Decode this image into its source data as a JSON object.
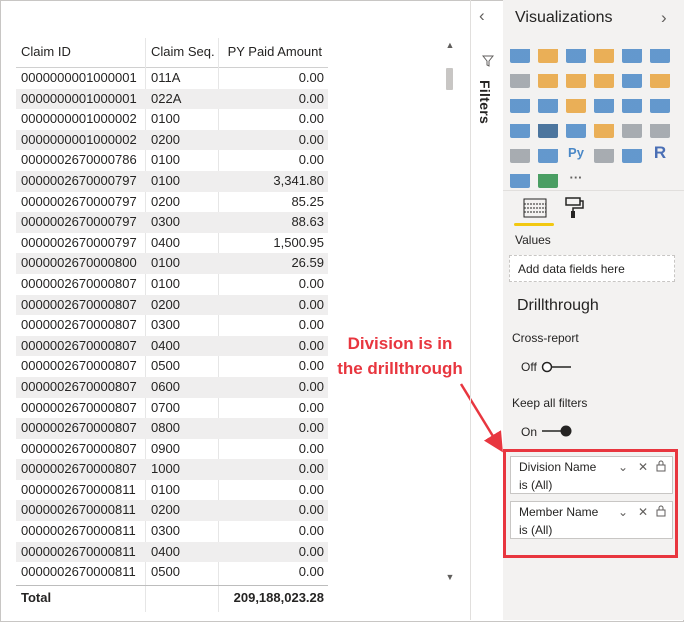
{
  "table": {
    "headers": [
      "Claim ID",
      "Claim Seq.",
      "PY Paid Amount"
    ],
    "rows": [
      [
        "0000000001000001",
        "011A",
        "0.00"
      ],
      [
        "0000000001000001",
        "022A",
        "0.00"
      ],
      [
        "0000000001000002",
        "0100",
        "0.00"
      ],
      [
        "0000000001000002",
        "0200",
        "0.00"
      ],
      [
        "0000002670000786",
        "0100",
        "0.00"
      ],
      [
        "0000002670000797",
        "0100",
        "3,341.80"
      ],
      [
        "0000002670000797",
        "0200",
        "85.25"
      ],
      [
        "0000002670000797",
        "0300",
        "88.63"
      ],
      [
        "0000002670000797",
        "0400",
        "1,500.95"
      ],
      [
        "0000002670000800",
        "0100",
        "26.59"
      ],
      [
        "0000002670000807",
        "0100",
        "0.00"
      ],
      [
        "0000002670000807",
        "0200",
        "0.00"
      ],
      [
        "0000002670000807",
        "0300",
        "0.00"
      ],
      [
        "0000002670000807",
        "0400",
        "0.00"
      ],
      [
        "0000002670000807",
        "0500",
        "0.00"
      ],
      [
        "0000002670000807",
        "0600",
        "0.00"
      ],
      [
        "0000002670000807",
        "0700",
        "0.00"
      ],
      [
        "0000002670000807",
        "0800",
        "0.00"
      ],
      [
        "0000002670000807",
        "0900",
        "0.00"
      ],
      [
        "0000002670000807",
        "1000",
        "0.00"
      ],
      [
        "0000002670000811",
        "0100",
        "0.00"
      ],
      [
        "0000002670000811",
        "0200",
        "0.00"
      ],
      [
        "0000002670000811",
        "0300",
        "0.00"
      ],
      [
        "0000002670000811",
        "0400",
        "0.00"
      ],
      [
        "0000002670000811",
        "0500",
        "0.00"
      ]
    ],
    "total": {
      "label": "Total",
      "value": "209,188,023.28"
    }
  },
  "filters_pane": {
    "label": "Filters",
    "collapse_icon": "chevron-left-icon",
    "funnel_icon": "funnel-icon"
  },
  "visualizations": {
    "title": "Visualizations",
    "expand_icon": "chevron-right-icon",
    "icons": [
      {
        "name": "stacked-bar-chart-icon",
        "color": "#4a88c7",
        "glyph": ""
      },
      {
        "name": "stacked-column-chart-icon",
        "color": "#e8a33c",
        "glyph": ""
      },
      {
        "name": "clustered-bar-chart-icon",
        "color": "#4a88c7",
        "glyph": ""
      },
      {
        "name": "clustered-column-chart-icon",
        "color": "#e8a33c",
        "glyph": ""
      },
      {
        "name": "100-stacked-bar-chart-icon",
        "color": "#4a88c7",
        "glyph": ""
      },
      {
        "name": "100-stacked-column-chart-icon",
        "color": "#4a88c7",
        "glyph": ""
      },
      {
        "name": "line-chart-icon",
        "color": "#9aa0a6",
        "glyph": ""
      },
      {
        "name": "area-chart-icon",
        "color": "#e8a33c",
        "glyph": ""
      },
      {
        "name": "stacked-area-chart-icon",
        "color": "#e8a33c",
        "glyph": ""
      },
      {
        "name": "line-and-column-chart-icon",
        "color": "#e8a33c",
        "glyph": ""
      },
      {
        "name": "line-and-clustered-column-chart-icon",
        "color": "#4a88c7",
        "glyph": ""
      },
      {
        "name": "ribbon-chart-icon",
        "color": "#e8a33c",
        "glyph": ""
      },
      {
        "name": "waterfall-chart-icon",
        "color": "#4a88c7",
        "glyph": ""
      },
      {
        "name": "scatter-chart-icon",
        "color": "#4a88c7",
        "glyph": ""
      },
      {
        "name": "pie-chart-icon",
        "color": "#e8a33c",
        "glyph": ""
      },
      {
        "name": "donut-chart-icon",
        "color": "#4a88c7",
        "glyph": ""
      },
      {
        "name": "treemap-icon",
        "color": "#4a88c7",
        "glyph": ""
      },
      {
        "name": "map-icon",
        "color": "#4a88c7",
        "glyph": ""
      },
      {
        "name": "filled-map-icon",
        "color": "#4a88c7",
        "glyph": ""
      },
      {
        "name": "shape-map-icon",
        "color": "#2f5f8f",
        "glyph": ""
      },
      {
        "name": "funnel-chart-icon",
        "color": "#4a88c7",
        "glyph": ""
      },
      {
        "name": "gauge-icon",
        "color": "#e8a33c",
        "glyph": ""
      },
      {
        "name": "card-icon",
        "color": "#9aa0a6",
        "glyph": ""
      },
      {
        "name": "multi-row-card-icon",
        "color": "#9aa0a6",
        "glyph": ""
      },
      {
        "name": "kpi-icon",
        "color": "#9aa0a6",
        "glyph": ""
      },
      {
        "name": "slicer-icon",
        "color": "#4a88c7",
        "glyph": ""
      },
      {
        "name": "python-visual-icon",
        "color": "#4a88c7",
        "glyph": "Py"
      },
      {
        "name": "table-icon",
        "color": "#9aa0a6",
        "glyph": ""
      },
      {
        "name": "matrix-icon",
        "color": "#4a88c7",
        "glyph": ""
      },
      {
        "name": "r-visual-icon",
        "color": "#4a6fb5",
        "glyph": "R"
      },
      {
        "name": "key-influencers-icon",
        "color": "#4a88c7",
        "glyph": ""
      },
      {
        "name": "arcgis-map-icon",
        "color": "#2c8f4a",
        "glyph": ""
      },
      {
        "name": "more-visuals-icon",
        "color": "#605e5c",
        "glyph": "···"
      }
    ],
    "tabs": {
      "fields_icon": "fields-icon",
      "format_icon": "paint-roller-icon"
    },
    "values_label": "Values",
    "add_fields_placeholder": "Add data fields here",
    "drillthrough": {
      "title": "Drillthrough",
      "cross_report_label": "Cross-report",
      "cross_report_state": "Off",
      "keep_filters_label": "Keep all filters",
      "keep_filters_state": "On",
      "filters": [
        {
          "name": "Division Name",
          "condition": "is (All)"
        },
        {
          "name": "Member Name",
          "condition": "is (All)"
        }
      ]
    }
  },
  "annotation": {
    "text_line1": "Division is in",
    "text_line2": "the drillthrough",
    "color": "#e8363f"
  }
}
